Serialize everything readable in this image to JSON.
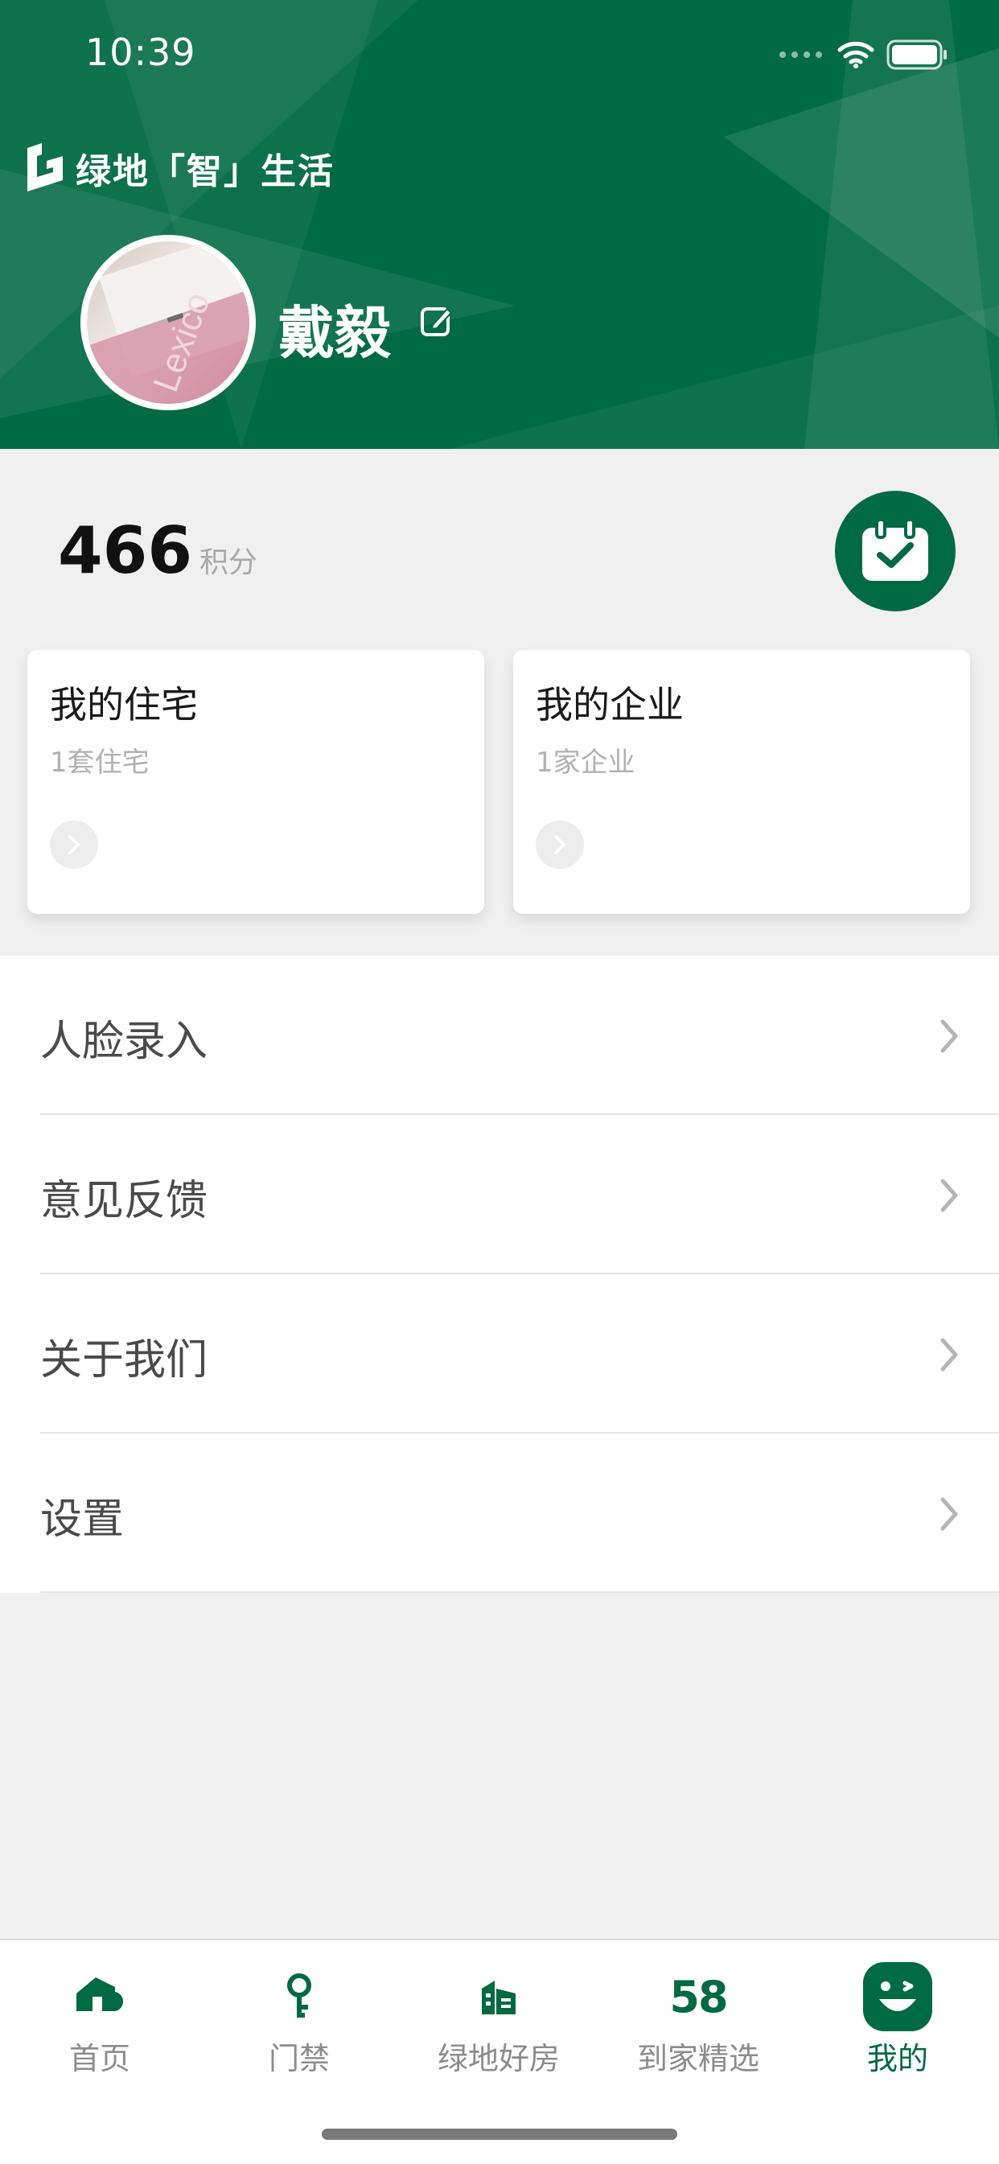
{
  "status_bar": {
    "time": "10:39"
  },
  "header": {
    "brand": "绿地「智」生活",
    "username": "戴毅",
    "accent_color": "#006a45",
    "avatar_text": "Lexico"
  },
  "points": {
    "value": "466",
    "unit": "积分",
    "checkin_icon": "calendar-check-icon"
  },
  "cards": [
    {
      "title": "我的住宅",
      "subtitle": "1套住宅"
    },
    {
      "title": "我的企业",
      "subtitle": "1家企业"
    }
  ],
  "menu": [
    {
      "label": "人脸录入"
    },
    {
      "label": "意见反馈"
    },
    {
      "label": "关于我们"
    },
    {
      "label": "设置"
    }
  ],
  "tabbar": [
    {
      "label": "首页",
      "icon": "home-icon"
    },
    {
      "label": "门禁",
      "icon": "key-icon"
    },
    {
      "label": "绿地好房",
      "icon": "buildings-icon"
    },
    {
      "label": "到家精选",
      "icon": "58-icon",
      "icon_text": "58"
    },
    {
      "label": "我的",
      "icon": "smiley-icon",
      "active": true
    }
  ]
}
